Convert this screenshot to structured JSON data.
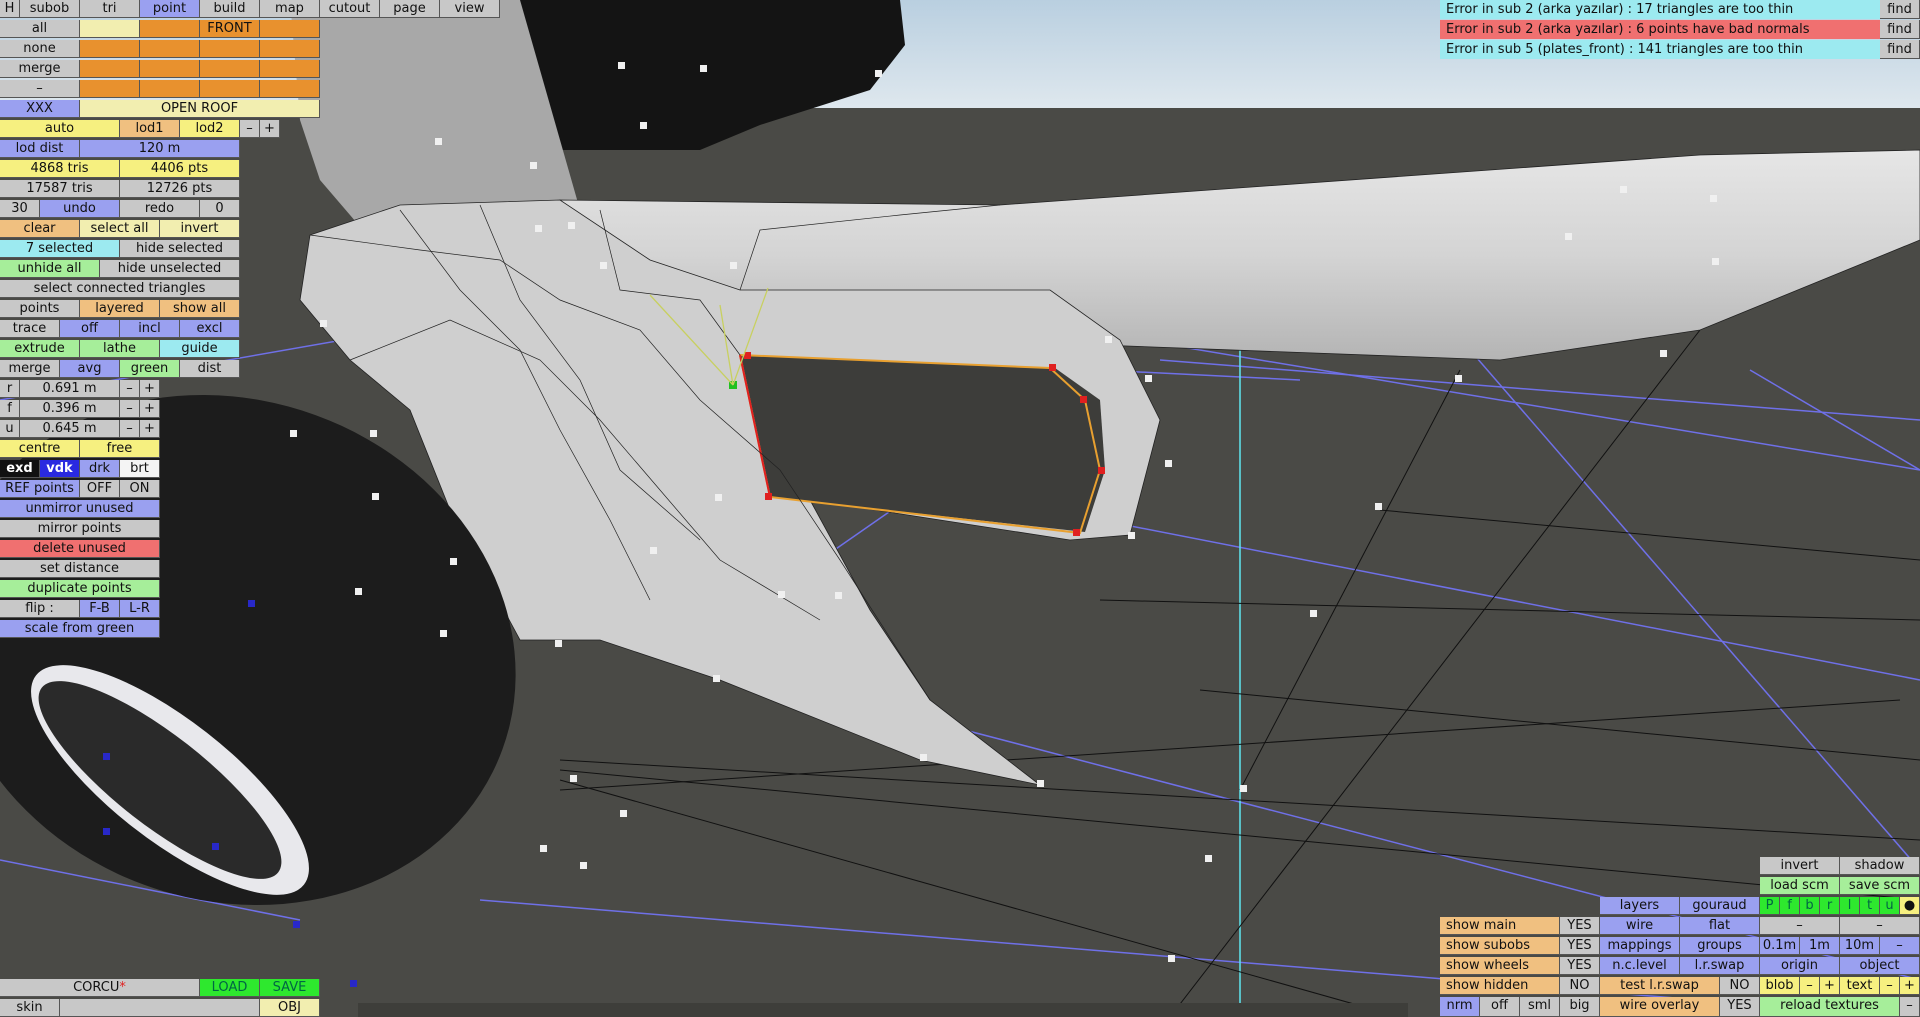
{
  "menu": [
    "H",
    "subob",
    "tri",
    "point",
    "build",
    "map",
    "cutout",
    "page",
    "view"
  ],
  "subob_list": {
    "all": "all",
    "none": "none",
    "merge": "merge",
    "dash": "–",
    "front": "FRONT",
    "xxx": "XXX",
    "open_roof": "OPEN ROOF"
  },
  "lod": {
    "auto": "auto",
    "lod1": "lod1",
    "lod2": "lod2",
    "minus": "–",
    "plus": "+",
    "dist_label": "lod dist",
    "dist_value": "120 m"
  },
  "stats": {
    "tris1": "4868 tris",
    "pts1": "4406 pts",
    "tris2": "17587 tris",
    "pts2": "12726 pts"
  },
  "history": {
    "count": "30",
    "undo": "undo",
    "redo": "redo",
    "zero": "0"
  },
  "selection": {
    "clear": "clear",
    "select_all": "select all",
    "invert": "invert",
    "selected": "7 selected",
    "hide_selected": "hide selected",
    "unhide_all": "unhide all",
    "hide_unselected": "hide unselected",
    "select_connected": "select connected triangles"
  },
  "points_row": {
    "points": "points",
    "layered": "layered",
    "show_all": "show all"
  },
  "trace_row": {
    "trace": "trace",
    "off": "off",
    "incl": "incl",
    "excl": "excl"
  },
  "extrude_row": {
    "extrude": "extrude",
    "lathe": "lathe",
    "guide": "guide"
  },
  "merge_row": {
    "merge": "merge",
    "avg": "avg",
    "green": "green",
    "dist": "dist"
  },
  "coords": {
    "r_label": "r",
    "r_value": "0.691 m",
    "f_label": "f",
    "f_value": "0.396 m",
    "u_label": "u",
    "u_value": "0.645 m",
    "minus": "–",
    "plus": "+"
  },
  "centre_row": {
    "centre": "centre",
    "free": "free"
  },
  "shade_row": {
    "exd": "exd",
    "vdk": "vdk",
    "drk": "drk",
    "brt": "brt"
  },
  "ref_row": {
    "ref": "REF points",
    "off": "OFF",
    "on": "ON"
  },
  "actions": {
    "unmirror": "unmirror unused",
    "mirror": "mirror points",
    "delete": "delete unused",
    "set_distance": "set distance",
    "duplicate": "duplicate points",
    "flip": "flip :",
    "fb": "F-B",
    "lr": "L-R",
    "scale": "scale from green"
  },
  "bottom_left": {
    "corcu": "CORCU",
    "star": "*",
    "load": "LOAD",
    "save": "SAVE",
    "skin": "skin",
    "obj": "OBJ"
  },
  "errors": [
    {
      "text": "Error in sub 2 (arka yazılar) : 17 triangles are too thin",
      "find": "find",
      "color": "#9ceaf0"
    },
    {
      "text": "Error in sub 2 (arka yazılar) : 6 points have bad normals",
      "find": "find",
      "color": "#f07070"
    },
    {
      "text": "Error in sub 5 (plates_front) : 141 triangles are too thin",
      "find": "find",
      "color": "#9ceaf0"
    }
  ],
  "br": {
    "invert": "invert",
    "shadow": "shadow",
    "load_scm": "load scm",
    "save_scm": "save scm",
    "layers": "layers",
    "gouraud": "gouraud",
    "letters": [
      "P",
      "f",
      "b",
      "r",
      "l",
      "t",
      "u",
      "●"
    ],
    "wire": "wire",
    "flat": "flat",
    "dash": "–",
    "show_main": "show main",
    "yes1": "YES",
    "show_subobs": "show subobs",
    "yes2": "YES",
    "mappings": "mappings",
    "groups": "groups",
    "d01": "0.1m",
    "d1": "1m",
    "d10": "10m",
    "show_wheels": "show wheels",
    "yes3": "YES",
    "nc_level": "n.c.level",
    "lr_swap": "l.r.swap",
    "origin": "origin",
    "object": "object",
    "show_hidden": "show hidden",
    "no1": "NO",
    "test_lr_swap": "test l.r.swap",
    "no2": "NO",
    "blob": "blob",
    "minus": "–",
    "plus": "+",
    "text": "text",
    "nrm": "nrm",
    "off": "off",
    "sml": "sml",
    "big": "big",
    "wire_overlay": "wire overlay",
    "yes4": "YES",
    "reload_textures": "reload textures"
  },
  "colors": {
    "ground": "#4a4a46",
    "sky": "#cfdde6",
    "body": "#d8d8d8",
    "grid": "#6f70e8",
    "selected_point": "#e02020",
    "green_point": "#22c020"
  }
}
